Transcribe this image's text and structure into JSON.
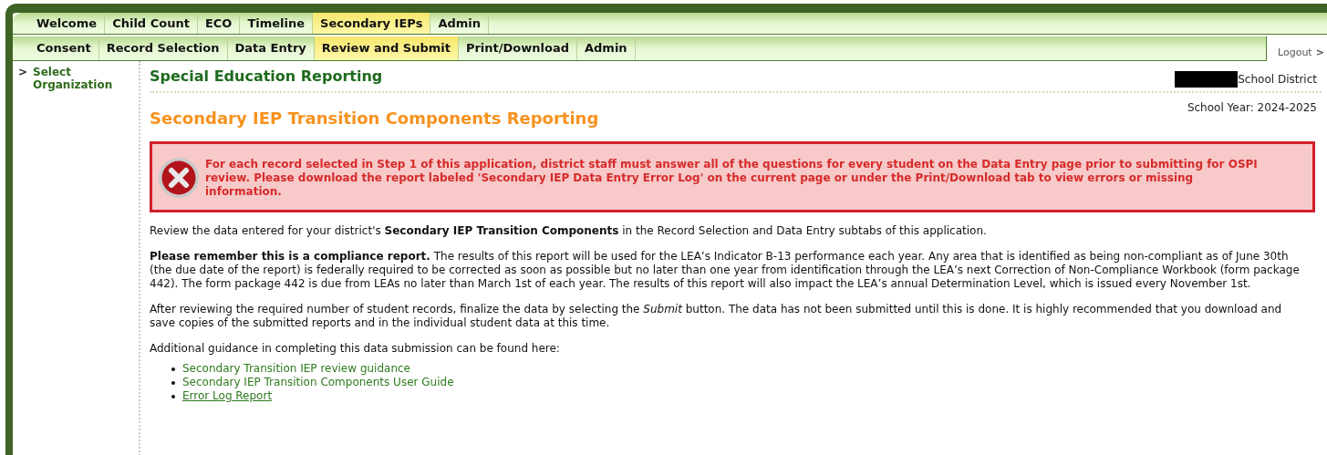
{
  "main_tabs": [
    {
      "label": "Welcome",
      "selected": false
    },
    {
      "label": "Child Count",
      "selected": false
    },
    {
      "label": "ECO",
      "selected": false
    },
    {
      "label": "Timeline",
      "selected": false
    },
    {
      "label": "Secondary IEPs",
      "selected": true
    },
    {
      "label": "Admin",
      "selected": false
    }
  ],
  "sub_tabs": [
    {
      "label": "Consent",
      "selected": false
    },
    {
      "label": "Record Selection",
      "selected": false
    },
    {
      "label": "Data Entry",
      "selected": false
    },
    {
      "label": "Review and Submit",
      "selected": true
    },
    {
      "label": "Print/Download",
      "selected": false
    },
    {
      "label": "Admin",
      "selected": false
    }
  ],
  "logout": {
    "label": "Logout",
    "icon": ">"
  },
  "sidebar": {
    "items": [
      {
        "label": "Select Organization",
        "icon": ">"
      }
    ]
  },
  "header": {
    "title": "Special Education Reporting",
    "district": "School District",
    "district_redacted": true,
    "school_year": "School Year: 2024-2025"
  },
  "page_title": "Secondary IEP Transition Components Reporting",
  "error_alert": {
    "message": "For each record selected in Step 1 of this application, district staff must answer all of the questions for every student on the Data Entry page prior to submitting for OSPI review. Please download the report labeled 'Secondary IEP Data Entry Error Log' on the current page or under the Print/Download tab to view errors or missing information."
  },
  "paragraphs": [
    "Review the data entered for your district's **Secondary IEP Transition Components** in the Record Selection and Data Entry subtabs of this application.",
    "**Please remember this is a compliance report.** The results of this report will be used for the LEA’s Indicator B-13 performance each year. Any area that is identified as being non-compliant as of June 30th (the due date of the report) is federally required to be corrected as soon as possible but no later than one year from identification through the LEA’s next Correction of Non-Compliance Workbook (form package 442). The form package 442 is due from LEAs no later than March 1st of each year. The results of this report will also impact the LEA’s annual Determination Level, which is issued every November 1st.",
    "After reviewing the required number of student records, finalize the data by selecting the *Submit* button. The data has not been submitted until this is done. It is highly recommended that you download and save copies of the submitted reports and in the individual student data at this time.",
    "Additional guidance in completing this data submission can be found here:"
  ],
  "links": [
    {
      "label": "Secondary Transition IEP review guidance",
      "underlined": false
    },
    {
      "label": "Secondary IEP Transition Components User Guide",
      "underlined": false
    },
    {
      "label": "Error Log Report",
      "underlined": true
    }
  ]
}
